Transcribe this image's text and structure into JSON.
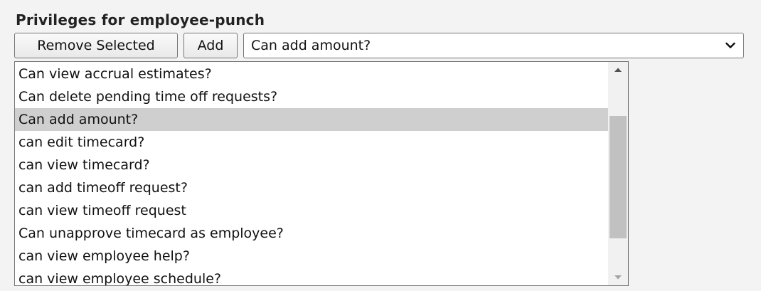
{
  "panel": {
    "title": "Privileges for employee-punch"
  },
  "toolbar": {
    "remove_label": "Remove Selected",
    "add_label": "Add",
    "select_value": "Can add amount?"
  },
  "list": {
    "items": [
      "Can view accrual estimates?",
      "Can delete pending time off requests?",
      "Can add amount?",
      "can edit timecard?",
      "can view timecard?",
      "can add timeoff request?",
      "can view timeoff request",
      "Can unapprove timecard as employee?",
      "can view employee help?",
      "can view employee schedule?"
    ],
    "selected_index": 2,
    "scroll_position_fraction": 0.55
  },
  "colors": {
    "selected_bg": "#cfcfcf",
    "scroll_thumb": "#c1c1c1"
  },
  "icons": {
    "dropdown": "chevron-down-icon",
    "scroll_up": "triangle-up-icon",
    "scroll_down": "triangle-down-icon"
  }
}
